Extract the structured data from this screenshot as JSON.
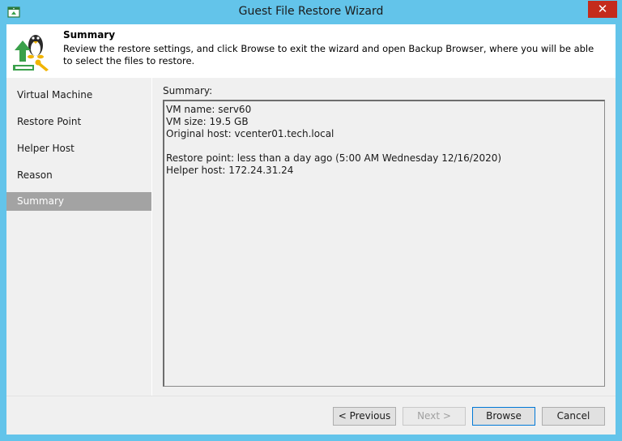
{
  "window": {
    "title": "Guest File Restore Wizard",
    "close_glyph": "✕"
  },
  "header": {
    "title": "Summary",
    "description": "Review the restore settings, and click Browse to exit the wizard and open Backup Browser, where you will be able to select the files to restore."
  },
  "nav": {
    "items": [
      {
        "label": "Virtual Machine",
        "active": false
      },
      {
        "label": "Restore Point",
        "active": false
      },
      {
        "label": "Helper Host",
        "active": false
      },
      {
        "label": "Reason",
        "active": false
      },
      {
        "label": "Summary",
        "active": true
      }
    ]
  },
  "summary": {
    "label": "Summary:",
    "lines": [
      "VM name: serv60",
      "VM size: 19.5 GB",
      "Original host: vcenter01.tech.local",
      "",
      "Restore point: less than a day ago (5:00 AM Wednesday 12/16/2020)",
      "Helper host: 172.24.31.24"
    ]
  },
  "buttons": {
    "previous": "< Previous",
    "next": "Next >",
    "browse": "Browse",
    "cancel": "Cancel"
  },
  "icons": {
    "app": "wizard-app-icon",
    "header": "linux-penguin-restore-icon",
    "close": "close-icon"
  },
  "colors": {
    "titlebar": "#63c4ea",
    "close": "#c42b1c",
    "nav_active": "#a3a3a3"
  }
}
